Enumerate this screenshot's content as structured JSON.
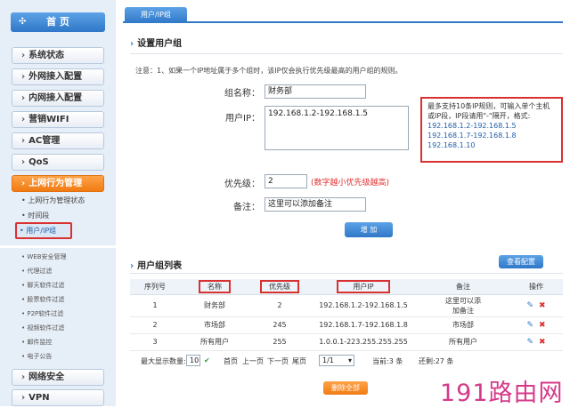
{
  "sidebar": {
    "home_label": "首 页",
    "items": [
      {
        "label": "系统状态"
      },
      {
        "label": "外网接入配置"
      },
      {
        "label": "内网接入配置"
      },
      {
        "label": "营销WIFI"
      },
      {
        "label": "AC管理"
      },
      {
        "label": "QoS"
      },
      {
        "label": "上网行为管理"
      }
    ],
    "sub_items": [
      "上网行为管理状态",
      "时间段",
      "用户/IP组"
    ],
    "sub_items2": [
      "WEB安全管理",
      "代理过滤",
      "聊天软件过滤",
      "股票软件过滤",
      "P2P软件过滤",
      "视频软件过滤",
      "邮件监控",
      "电子公告"
    ],
    "bottom_items": [
      {
        "label": "网络安全"
      },
      {
        "label": "VPN"
      }
    ]
  },
  "tab": {
    "label": "用户/IP组"
  },
  "form": {
    "section_title": "设置用户组",
    "note": "注意：1、如果一个IP地址属于多个组时，该IP仅会执行优先级最高的用户组的规则。",
    "group_name_label": "组名称：",
    "group_name_value": "财务部",
    "user_ip_label": "用户IP：",
    "user_ip_value": "192.168.1.2-192.168.1.5",
    "hint_text": "最多支持10条IP规则，可输入单个主机或IP段，IP段请用\"-\"隔开，格式:",
    "hint_examples": [
      "192.168.1.2-192.168.1.5",
      "192.168.1.7-192.168.1.8",
      "192.168.1.10"
    ],
    "priority_label": "优先级：",
    "priority_value": "2",
    "priority_hint": "(数字越小优先级越高)",
    "remark_label": "备注：",
    "remark_value": "这里可以添加备注",
    "add_button": "增 加"
  },
  "list": {
    "section_title": "用户组列表",
    "view_button": "查看配置",
    "columns": [
      "序列号",
      "名称",
      "优先级",
      "用户IP",
      "备注",
      "操作"
    ],
    "rows": [
      {
        "id": "1",
        "name": "财务部",
        "priority": "2",
        "ip": "192.168.1.2-192.168.1.5",
        "remark1": "这里可以添",
        "remark2": "加备注"
      },
      {
        "id": "2",
        "name": "市场部",
        "priority": "245",
        "ip": "192.168.1.7-192.168.1.8",
        "remark1": "市场部",
        "remark2": ""
      },
      {
        "id": "3",
        "name": "所有用户",
        "priority": "255",
        "ip": "1.0.0.1-223.255.255.255",
        "remark1": "所有用户",
        "remark2": ""
      }
    ],
    "max_display_label": "最大显示数量:",
    "max_display_value": "10",
    "first": "首页",
    "prev": "上一页",
    "next": "下一页",
    "last": "尾页",
    "page_select": "1/1",
    "current_label": "当前:3 条",
    "total_label": "还剩:27 条",
    "delete_all_button": "删除全部"
  },
  "watermark": "191路由网",
  "colors": {
    "accent": "#2f78c8",
    "active": "#f07b12",
    "highlight": "#d93030",
    "watermark": "#d53a8a"
  }
}
